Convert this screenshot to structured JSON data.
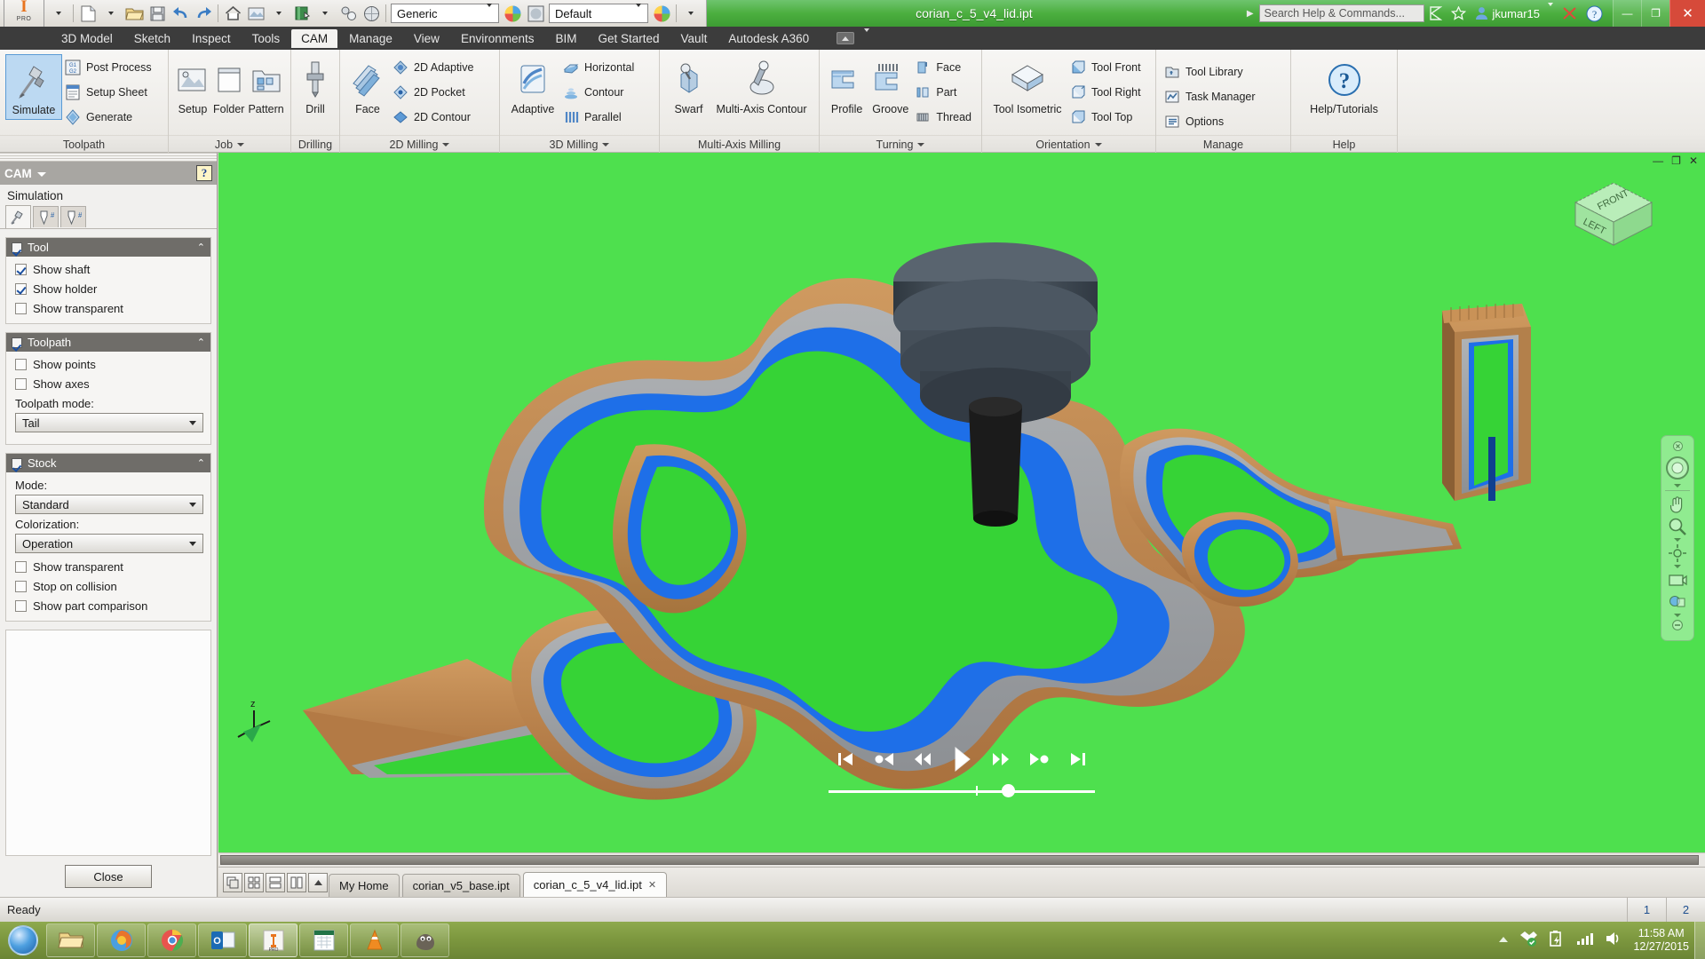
{
  "titlebar": {
    "document_title": "corian_c_5_v4_lid.ipt",
    "quick_access": [
      {
        "name": "new-file",
        "icon": "new-file-icon"
      },
      {
        "name": "open-file",
        "icon": "open-folder-icon"
      },
      {
        "name": "save-file",
        "icon": "save-disk-icon"
      },
      {
        "name": "undo",
        "icon": "undo-arrow-icon"
      },
      {
        "name": "redo",
        "icon": "redo-arrow-icon"
      },
      {
        "name": "home-view",
        "icon": "home-icon"
      },
      {
        "name": "appearance",
        "icon": "appearance-icon"
      },
      {
        "name": "material-library",
        "icon": "book-icon"
      },
      {
        "name": "parameters",
        "icon": "parameters-icon"
      },
      {
        "name": "visual-style",
        "icon": "sphere-style-icon"
      }
    ],
    "material_combo": "Generic",
    "appearance_combo": "Default",
    "search_placeholder": "Search Help & Commands...",
    "user_name": "jkumar15",
    "window_buttons": [
      "minimize",
      "restore",
      "close"
    ]
  },
  "ribbon": {
    "tabs": [
      {
        "label": "3D Model",
        "active": false
      },
      {
        "label": "Sketch",
        "active": false
      },
      {
        "label": "Inspect",
        "active": false
      },
      {
        "label": "Tools",
        "active": false
      },
      {
        "label": "CAM",
        "active": true
      },
      {
        "label": "Manage",
        "active": false
      },
      {
        "label": "View",
        "active": false
      },
      {
        "label": "Environments",
        "active": false
      },
      {
        "label": "BIM",
        "active": false
      },
      {
        "label": "Get Started",
        "active": false
      },
      {
        "label": "Vault",
        "active": false
      },
      {
        "label": "Autodesk A360",
        "active": false
      }
    ],
    "panels": [
      {
        "label": "Toolpath",
        "has_dropdown": false,
        "big": [
          {
            "label": "Simulate",
            "icon": "simulate-icon",
            "selected": true
          }
        ],
        "small": [
          {
            "label": "Post Process",
            "icon": "post-process-icon"
          },
          {
            "label": "Setup Sheet",
            "icon": "setup-sheet-icon"
          },
          {
            "label": "Generate",
            "icon": "generate-icon"
          }
        ]
      },
      {
        "label": "Job",
        "has_dropdown": true,
        "big": [
          {
            "label": "Setup",
            "icon": "setup-icon",
            "selected": false
          },
          {
            "label": "Folder",
            "icon": "folder-icon",
            "selected": false
          },
          {
            "label": "Pattern",
            "icon": "pattern-icon",
            "selected": false
          }
        ],
        "small": []
      },
      {
        "label": "Drilling",
        "has_dropdown": false,
        "big": [
          {
            "label": "Drill",
            "icon": "drill-icon",
            "selected": false
          }
        ],
        "small": []
      },
      {
        "label": "2D Milling",
        "has_dropdown": true,
        "big": [
          {
            "label": "Face",
            "icon": "face-mill-icon",
            "selected": false
          }
        ],
        "small": [
          {
            "label": "2D Adaptive",
            "icon": "2d-adaptive-icon"
          },
          {
            "label": "2D Pocket",
            "icon": "2d-pocket-icon"
          },
          {
            "label": "2D Contour",
            "icon": "2d-contour-icon"
          }
        ]
      },
      {
        "label": "3D Milling",
        "has_dropdown": true,
        "big": [
          {
            "label": "Adaptive",
            "icon": "adaptive-icon",
            "selected": false
          }
        ],
        "small": [
          {
            "label": "Horizontal",
            "icon": "horizontal-icon"
          },
          {
            "label": "Contour",
            "icon": "contour-icon"
          },
          {
            "label": "Parallel",
            "icon": "parallel-icon"
          }
        ]
      },
      {
        "label": "Multi-Axis Milling",
        "has_dropdown": false,
        "big": [
          {
            "label": "Swarf",
            "icon": "swarf-icon",
            "selected": false
          },
          {
            "label": "Multi-Axis Contour",
            "icon": "multi-axis-contour-icon",
            "selected": false
          }
        ],
        "small": []
      },
      {
        "label": "Turning",
        "has_dropdown": true,
        "big": [
          {
            "label": "Profile",
            "icon": "turning-profile-icon",
            "selected": false
          },
          {
            "label": "Groove",
            "icon": "turning-groove-icon",
            "selected": false
          }
        ],
        "small": [
          {
            "label": "Face",
            "icon": "turning-face-icon"
          },
          {
            "label": "Part",
            "icon": "turning-part-icon"
          },
          {
            "label": "Thread",
            "icon": "turning-thread-icon"
          }
        ]
      },
      {
        "label": "Orientation",
        "has_dropdown": true,
        "big": [
          {
            "label": "Tool Isometric",
            "icon": "tool-isometric-icon",
            "selected": false
          }
        ],
        "small": [
          {
            "label": "Tool Front",
            "icon": "tool-front-icon"
          },
          {
            "label": "Tool Right",
            "icon": "tool-right-icon"
          },
          {
            "label": "Tool Top",
            "icon": "tool-top-icon"
          }
        ]
      },
      {
        "label": "Manage",
        "has_dropdown": false,
        "big": [],
        "small": [
          {
            "label": "Tool Library",
            "icon": "tool-library-icon"
          },
          {
            "label": "Task Manager",
            "icon": "task-manager-icon"
          },
          {
            "label": "Options",
            "icon": "options-icon"
          }
        ]
      },
      {
        "label": "Help",
        "has_dropdown": false,
        "big": [
          {
            "label": "Help/Tutorials",
            "icon": "help-question-icon",
            "selected": false
          }
        ],
        "small": []
      }
    ]
  },
  "cam_panel": {
    "header_title": "CAM",
    "help_icon": "help-marker-icon",
    "section_title": "Simulation",
    "tabs": [
      {
        "name": "tab-simulation",
        "icon": "toolpath-sim-icon",
        "active": true
      },
      {
        "name": "tab-tool-1",
        "icon": "tool-number-icon",
        "active": false
      },
      {
        "name": "tab-tool-2",
        "icon": "tool-number-icon",
        "active": false
      }
    ],
    "groups": [
      {
        "title": "Tool",
        "enabled": true,
        "collapsed": false,
        "checkboxes": [
          {
            "label": "Show shaft",
            "checked": true
          },
          {
            "label": "Show holder",
            "checked": true
          },
          {
            "label": "Show transparent",
            "checked": false
          }
        ],
        "fields": []
      },
      {
        "title": "Toolpath",
        "enabled": true,
        "collapsed": false,
        "checkboxes": [
          {
            "label": "Show points",
            "checked": false
          },
          {
            "label": "Show axes",
            "checked": false
          }
        ],
        "fields": [
          {
            "label": "Toolpath mode:",
            "value": "Tail"
          }
        ]
      },
      {
        "title": "Stock",
        "enabled": true,
        "collapsed": false,
        "checkboxes": [
          {
            "label": "Show transparent",
            "checked": false
          },
          {
            "label": "Stop on collision",
            "checked": false
          },
          {
            "label": "Show part comparison",
            "checked": false
          }
        ],
        "fields": [
          {
            "label": "Mode:",
            "value": "Standard"
          },
          {
            "label": "Colorization:",
            "value": "Operation"
          }
        ]
      }
    ],
    "close_label": "Close"
  },
  "viewport": {
    "background_color": "#4ee04e",
    "viewcube": {
      "face_top": "FRONT",
      "face_left": "LEFT"
    },
    "navigation_bar": [
      {
        "name": "steering-wheel-icon"
      },
      {
        "name": "pan-hand-icon"
      },
      {
        "name": "zoom-magnifier-icon"
      },
      {
        "name": "orbit-icon"
      },
      {
        "name": "look-camera-icon"
      },
      {
        "name": "display-style-icon"
      }
    ],
    "stock_colors": {
      "machined": "#4ee04e",
      "stock_tan": "#c08a52",
      "stock_grey": "#9ea0a2",
      "toolpath_blue": "#1e6fe8",
      "tool_body": "#4b5560",
      "tool_shank": "#1b1b1b"
    },
    "playback": {
      "buttons": [
        {
          "name": "skip-to-start-button",
          "icon": "skip-start-icon"
        },
        {
          "name": "step-back-operation-button",
          "icon": "step-back-op-icon"
        },
        {
          "name": "rewind-button",
          "icon": "rewind-icon"
        },
        {
          "name": "play-button",
          "icon": "play-icon"
        },
        {
          "name": "fast-forward-button",
          "icon": "fast-forward-icon"
        },
        {
          "name": "step-forward-operation-button",
          "icon": "step-forward-op-icon"
        },
        {
          "name": "skip-to-end-button",
          "icon": "skip-end-icon"
        }
      ],
      "progress_percent": 65
    }
  },
  "doc_tabs": {
    "layout_buttons": [
      {
        "name": "cascade-windows-button",
        "icon": "cascade-icon"
      },
      {
        "name": "tile-windows-button",
        "icon": "tile-grid-icon"
      },
      {
        "name": "tile-horizontal-button",
        "icon": "tile-horizontal-icon"
      },
      {
        "name": "tile-vertical-button",
        "icon": "tile-vertical-icon"
      },
      {
        "name": "tab-scroll-up-button",
        "icon": "chevron-up-icon"
      }
    ],
    "tabs": [
      {
        "label": "My Home",
        "active": false,
        "closable": false
      },
      {
        "label": "corian_v5_base.ipt",
        "active": false,
        "closable": false
      },
      {
        "label": "corian_c_5_v4_lid.ipt",
        "active": true,
        "closable": true
      }
    ],
    "close_glyph": "✕"
  },
  "statusbar": {
    "status_text": "Ready",
    "cells": [
      "1",
      "2"
    ]
  },
  "taskbar": {
    "start_button": "start-orb-button",
    "apps": [
      {
        "name": "windows-explorer-taskbar-button",
        "icon": "folder-icon",
        "active": false
      },
      {
        "name": "firefox-taskbar-button",
        "icon": "firefox-icon",
        "active": false
      },
      {
        "name": "chrome-taskbar-button",
        "icon": "chrome-icon",
        "active": false
      },
      {
        "name": "outlook-taskbar-button",
        "icon": "outlook-icon",
        "active": false
      },
      {
        "name": "inventor-taskbar-button",
        "icon": "inventor-icon",
        "active": true
      },
      {
        "name": "excel-taskbar-button",
        "icon": "excel-icon",
        "active": false
      },
      {
        "name": "vlc-taskbar-button",
        "icon": "vlc-cone-icon",
        "active": false
      },
      {
        "name": "gimp-taskbar-button",
        "icon": "gimp-icon",
        "active": false
      }
    ],
    "tray": [
      {
        "name": "show-hidden-icons-button",
        "icon": "chevron-up-icon"
      },
      {
        "name": "dropbox-tray-icon",
        "icon": "dropbox-icon"
      },
      {
        "name": "battery-tray-icon",
        "icon": "battery-icon"
      },
      {
        "name": "network-tray-icon",
        "icon": "signal-bars-icon"
      },
      {
        "name": "volume-tray-icon",
        "icon": "speaker-icon"
      }
    ],
    "clock_time": "11:58 AM",
    "clock_date": "12/27/2015"
  }
}
